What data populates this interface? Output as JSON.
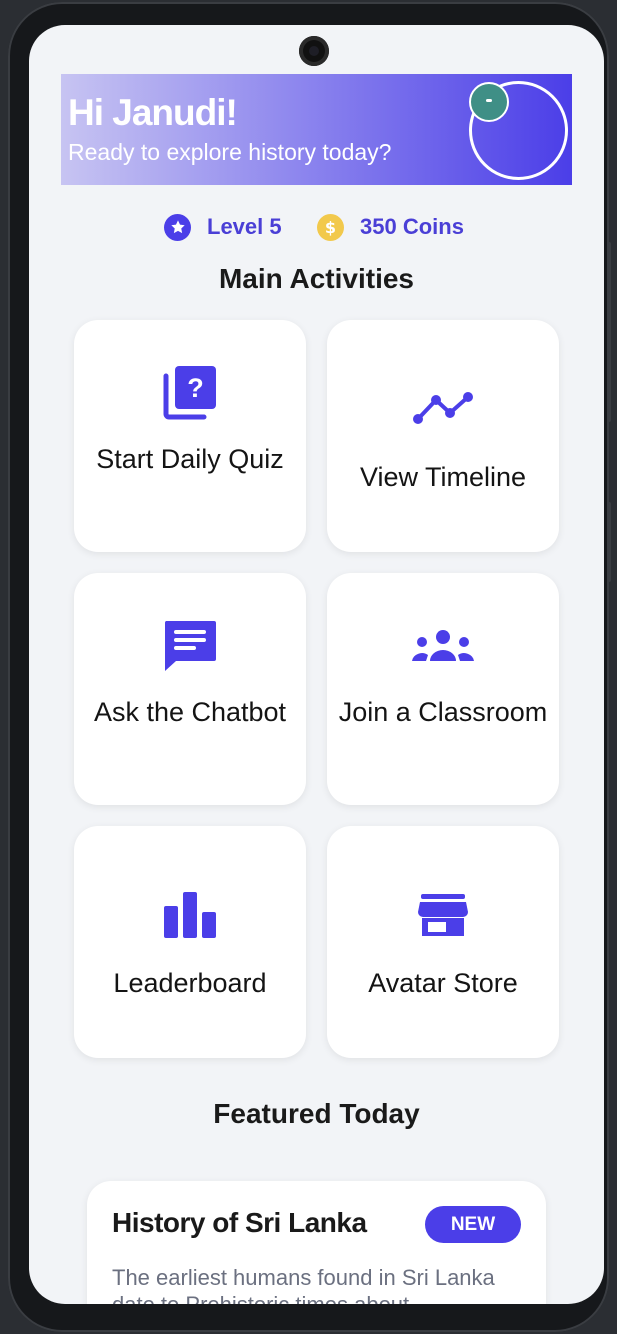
{
  "header": {
    "greeting": "Hi Janudi!",
    "subtitle": "Ready to explore history today?"
  },
  "stats": {
    "level": "Level 5",
    "coins": "350 Coins",
    "coin_symbol": "$"
  },
  "main_activities": {
    "title": "Main Activities",
    "items": [
      {
        "label": "Start Daily Quiz",
        "icon": "quiz-icon"
      },
      {
        "label": "View Timeline",
        "icon": "timeline-icon"
      },
      {
        "label": "Ask the Chatbot",
        "icon": "chat-icon"
      },
      {
        "label": "Join a Classroom",
        "icon": "group-icon"
      },
      {
        "label": "Leaderboard",
        "icon": "leaderboard-icon"
      },
      {
        "label": "Avatar Store",
        "icon": "store-icon"
      }
    ]
  },
  "featured": {
    "title": "Featured Today",
    "card_title": "History of Sri Lanka",
    "badge": "NEW",
    "text": "The earliest humans found in Sri Lanka date to Prehistoric times about"
  },
  "colors": {
    "accent": "#4b3ee8",
    "coin": "#f2c94c",
    "background": "#f2f4f7"
  }
}
